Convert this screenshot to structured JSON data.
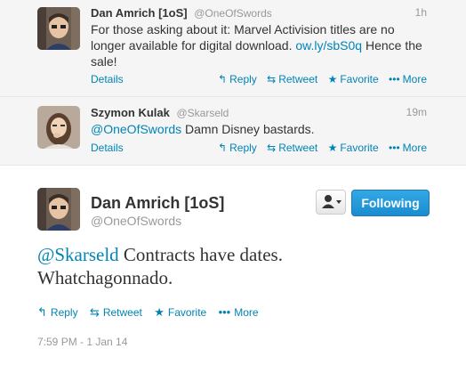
{
  "tweet1": {
    "fullname": "Dan Amrich [1oS]",
    "username": "@OneOfSwords",
    "time": "1h",
    "text_before": "For those asking about it: Marvel Activision titles are no longer available for digital download. ",
    "link": "ow.ly/sbS0q",
    "text_after": " Hence the sale!",
    "details": "Details",
    "actions": [
      "Reply",
      "Retweet",
      "Favorite",
      "More"
    ]
  },
  "tweet2": {
    "fullname": "Szymon Kulak",
    "username": "@Skarseld",
    "time": "19m",
    "mention": "@OneOfSwords",
    "text": " Damn Disney bastards.",
    "details": "Details",
    "actions": [
      "Reply",
      "Retweet",
      "Favorite",
      "More"
    ]
  },
  "main": {
    "fullname": "Dan Amrich [1oS]",
    "username": "@OneOfSwords",
    "follow_label": "Following",
    "mention": "@Skarseld",
    "text_line1": " Contracts have dates.",
    "text_line2": "Whatchagonnado.",
    "actions": [
      "Reply",
      "Retweet",
      "Favorite",
      "More"
    ],
    "timestamp": "7:59 PM - 1 Jan 14"
  },
  "icons": {
    "reply": "reply-arrow",
    "retweet": "retweet-arrows",
    "favorite": "star",
    "more": "ellipsis-dots",
    "user": "person-dropdown"
  },
  "colors": {
    "link": "#0084b4",
    "muted": "#999999",
    "text": "#333333",
    "follow_button": "#1a8ccf"
  }
}
